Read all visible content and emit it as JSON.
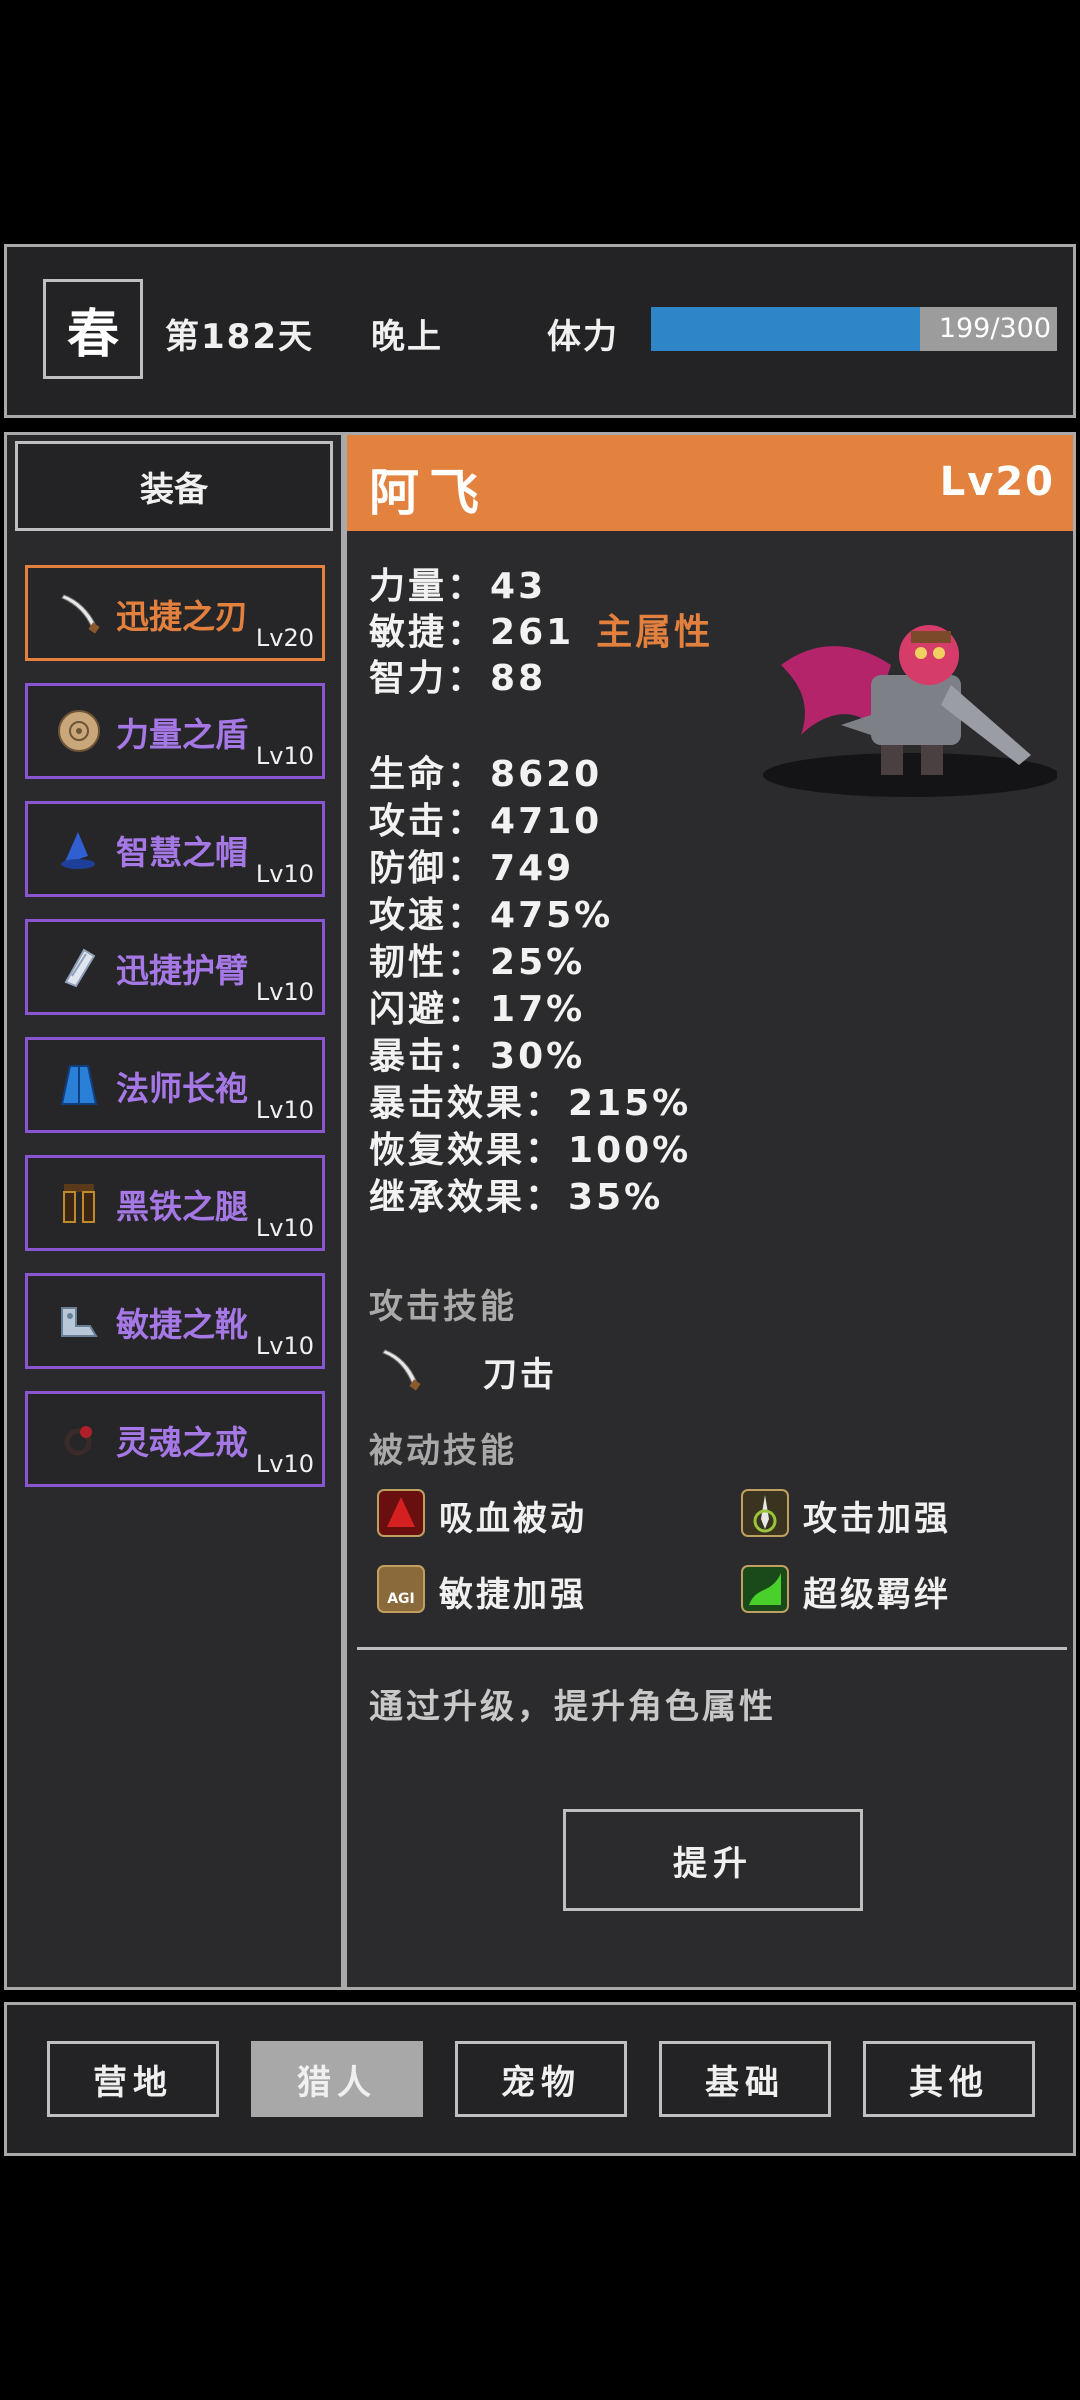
{
  "header": {
    "season": "春",
    "day": "第182天",
    "time_of_day": "晚上",
    "stamina_label": "体力",
    "stamina_text": "199/300",
    "stamina_fraction": 0.663
  },
  "equipment": {
    "title": "装备",
    "items": [
      {
        "name": "迅捷之刃",
        "level": "Lv20",
        "icon": "blade-icon",
        "selected": true
      },
      {
        "name": "力量之盾",
        "level": "Lv10",
        "icon": "shield-icon"
      },
      {
        "name": "智慧之帽",
        "level": "Lv10",
        "icon": "wizard-hat-icon"
      },
      {
        "name": "迅捷护臂",
        "level": "Lv10",
        "icon": "bracer-icon"
      },
      {
        "name": "法师长袍",
        "level": "Lv10",
        "icon": "robe-icon"
      },
      {
        "name": "黑铁之腿",
        "level": "Lv10",
        "icon": "leg-armor-icon"
      },
      {
        "name": "敏捷之靴",
        "level": "Lv10",
        "icon": "boots-icon"
      },
      {
        "name": "灵魂之戒",
        "level": "Lv10",
        "icon": "ring-icon"
      }
    ]
  },
  "hero": {
    "name": "阿飞",
    "level": "Lv20",
    "primary": [
      {
        "label": "力量：",
        "value": "43"
      },
      {
        "label": "敏捷：",
        "value": "261",
        "note": "主属性"
      },
      {
        "label": "智力：",
        "value": "88"
      }
    ],
    "stats": [
      {
        "label": "生命：",
        "value": "8620"
      },
      {
        "label": "攻击：",
        "value": "4710"
      },
      {
        "label": "防御：",
        "value": "749"
      },
      {
        "label": "攻速：",
        "value": "475%"
      },
      {
        "label": "韧性：",
        "value": "25%"
      },
      {
        "label": "闪避：",
        "value": "17%"
      },
      {
        "label": "暴击：",
        "value": "30%"
      },
      {
        "label": "暴击效果：",
        "value": "215%"
      },
      {
        "label": "恢复效果：",
        "value": "100%"
      },
      {
        "label": "继承效果：",
        "value": "35%"
      }
    ],
    "attack_skill_title": "攻击技能",
    "attack_skill": "刀击",
    "passive_skill_title": "被动技能",
    "passives": [
      "吸血被动",
      "攻击加强",
      "敏捷加强",
      "超级羁绊"
    ],
    "upgrade_desc": "通过升级，提升角色属性",
    "upgrade_button": "提升"
  },
  "nav": {
    "tabs": [
      "营地",
      "猎人",
      "宠物",
      "基础",
      "其他"
    ],
    "active_index": 1
  },
  "colors": {
    "accent_orange": "#e3813f",
    "equip_purple": "#8a55d0",
    "stamina_blue": "#2e86c9"
  }
}
